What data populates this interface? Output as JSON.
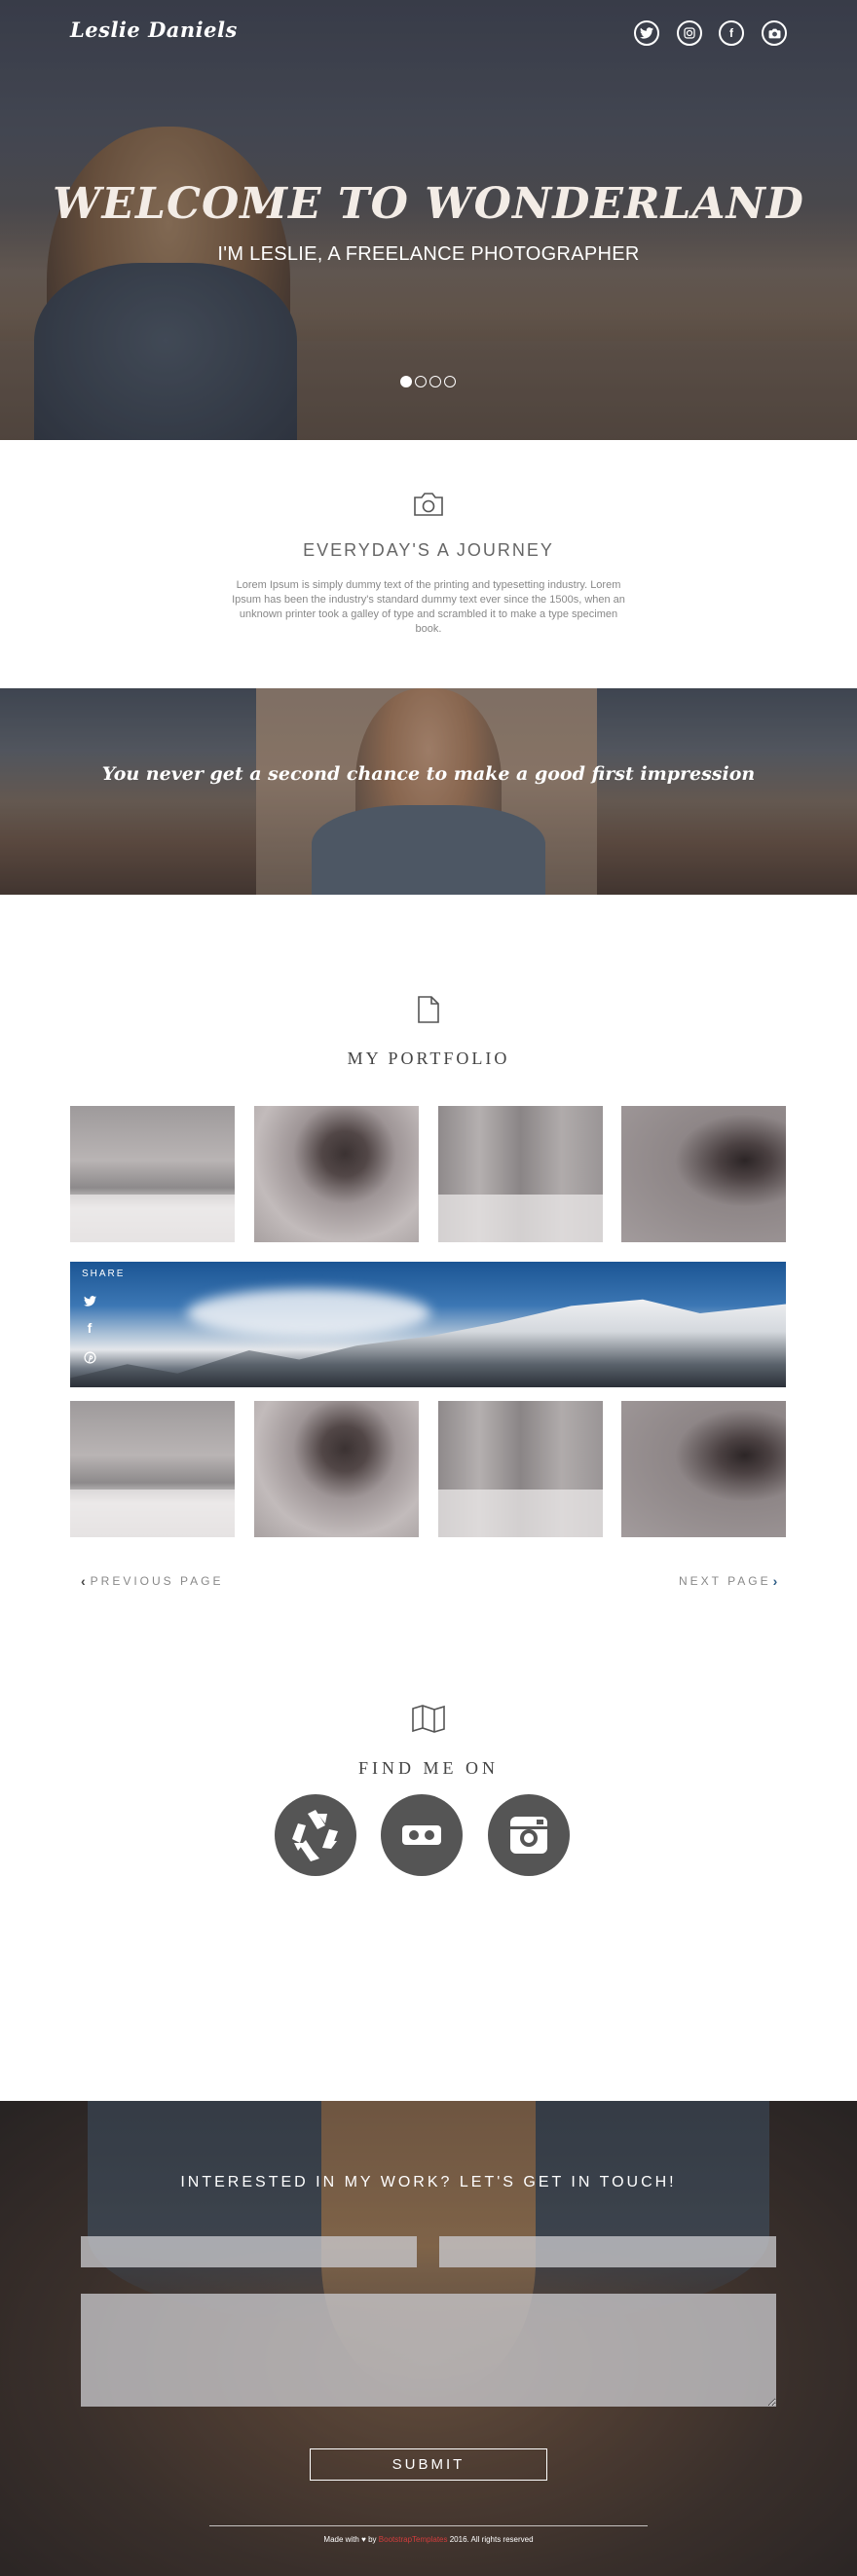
{
  "header": {
    "logo": "Leslie Daniels",
    "social": [
      {
        "icon": "twitter-icon",
        "glyph": "t"
      },
      {
        "icon": "instagram-icon",
        "glyph": "◙"
      },
      {
        "icon": "facebook-icon",
        "glyph": "f"
      },
      {
        "icon": "camera-icon",
        "glyph": "◉"
      }
    ]
  },
  "hero": {
    "title": "WELCOME TO WONDERLAND",
    "subtitle": "I'M LESLIE, A FREELANCE PHOTOGRAPHER",
    "slides": 4,
    "active_slide": 1
  },
  "journey": {
    "title": "EVERYDAY'S A JOURNEY",
    "text": "Lorem Ipsum is simply dummy text of the printing and typesetting industry. Lorem Ipsum has been the industry's standard dummy text ever since the 1500s, when an unknown printer took a galley of type and scrambled it to make a type specimen book."
  },
  "quote": {
    "text": "You never get a second chance to make a good first impression"
  },
  "portfolio": {
    "title": "MY PORTFOLIO",
    "share_label": "SHARE",
    "share_icons": [
      {
        "icon": "twitter-icon",
        "glyph": "✦"
      },
      {
        "icon": "facebook-icon",
        "glyph": "f"
      },
      {
        "icon": "pinterest-icon",
        "glyph": "℗"
      }
    ],
    "prev": "PREVIOUS PAGE",
    "next": "NEXT PAGE"
  },
  "find": {
    "title": "FIND ME ON",
    "profiles": [
      "recycle-icon",
      "flickr-icon",
      "instagram-icon"
    ]
  },
  "contact": {
    "title": "INTERESTED IN MY WORK? LET'S GET IN TOUCH!",
    "submit": "SUBMIT"
  },
  "footer": {
    "made_with": "Made with",
    "by": "by",
    "brand": "BootstrapTemplates",
    "rights": "2016. All rights reserved"
  },
  "colors": {
    "accent_link": "#2f5d86",
    "footer_brand": "#d23c3c",
    "social_circle": "#555555"
  }
}
